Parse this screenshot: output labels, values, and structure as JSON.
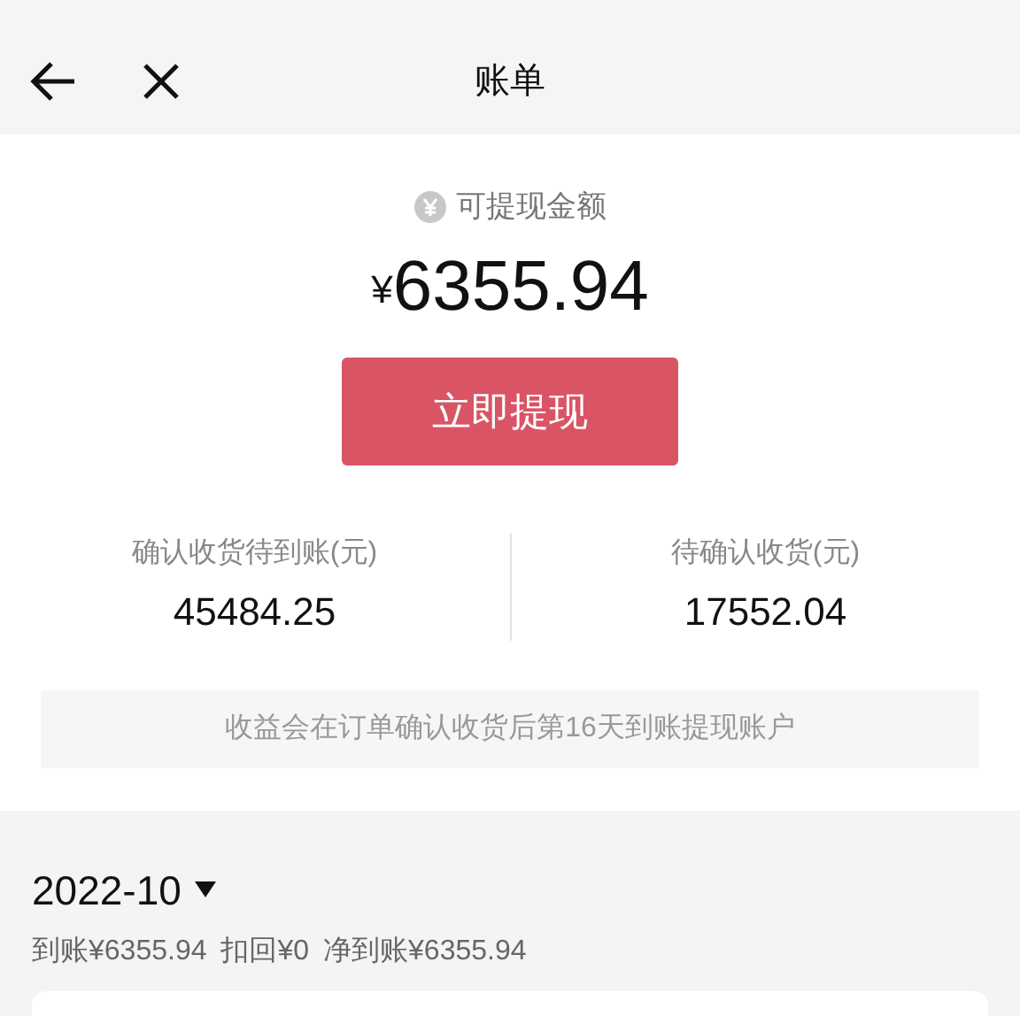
{
  "header": {
    "title": "账单"
  },
  "balance": {
    "label": "可提现金额",
    "currency": "¥",
    "amount": "6355.94",
    "button": "立即提现"
  },
  "stats": [
    {
      "label": "确认收货待到账(元)",
      "value": "45484.25"
    },
    {
      "label": "待确认收货(元)",
      "value": "17552.04"
    }
  ],
  "notice": "收益会在订单确认收货后第16天到账提现账户",
  "month": {
    "title": "2022-10",
    "summary": [
      "到账¥6355.94",
      "扣回¥0",
      "净到账¥6355.94"
    ]
  }
}
